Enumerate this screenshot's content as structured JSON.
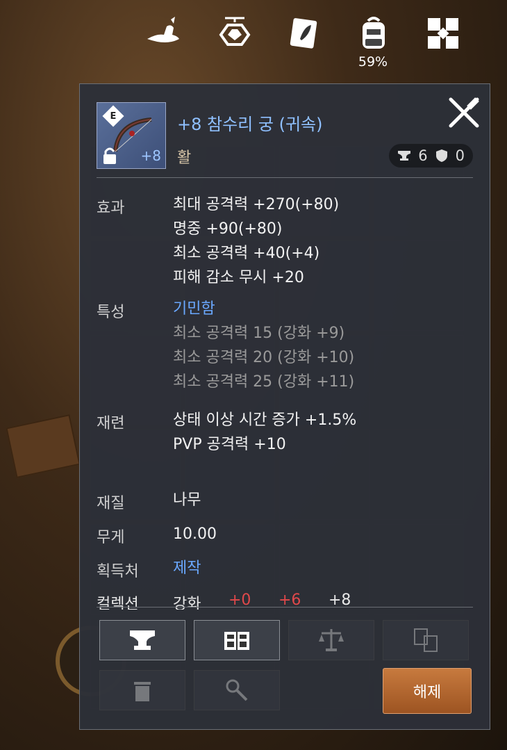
{
  "topbar": {
    "icons": [
      "hat-icon",
      "diamond-emblem-icon",
      "leaf-book-icon",
      "backpack-icon",
      "menu-grid-icon"
    ],
    "bag_percent": "59%"
  },
  "item": {
    "icon_level": "+8",
    "icon_grade": "E",
    "name": "+8 참수리 궁 (귀속)",
    "type": "활",
    "anvil_count": "6",
    "shield_count": "0"
  },
  "effects": {
    "label": "효과",
    "lines": [
      "최대 공격력 +270(+80)",
      "명중 +90(+80)",
      "최소 공격력 +40(+4)",
      "피해 감소 무시 +20"
    ]
  },
  "trait": {
    "label": "특성",
    "name": "기민함",
    "lines": [
      "최소 공격력 15 (강화 +9)",
      "최소 공격력 20 (강화 +10)",
      "최소 공격력 25 (강화 +11)"
    ]
  },
  "refine": {
    "label": "재련",
    "lines": [
      "상태 이상 시간 증가 +1.5%",
      "PVP 공격력 +10"
    ]
  },
  "material": {
    "label": "재질",
    "value": "나무"
  },
  "weight": {
    "label": "무게",
    "value": "10.00"
  },
  "source": {
    "label": "획득처",
    "value": "제작"
  },
  "collection": {
    "label": "컬렉션",
    "prefix": "강화",
    "values": [
      "+0",
      "+6",
      "+8"
    ]
  },
  "actions": {
    "buttons": [
      "anvil-icon",
      "codex-icon",
      "scale-icon",
      "swap-icon",
      "trash-icon",
      "tools-icon"
    ],
    "release_label": "해제"
  },
  "colors": {
    "name_blue": "#8fc0ff",
    "trait_blue": "#6aa8ff",
    "release_orange": "#b86a30"
  }
}
